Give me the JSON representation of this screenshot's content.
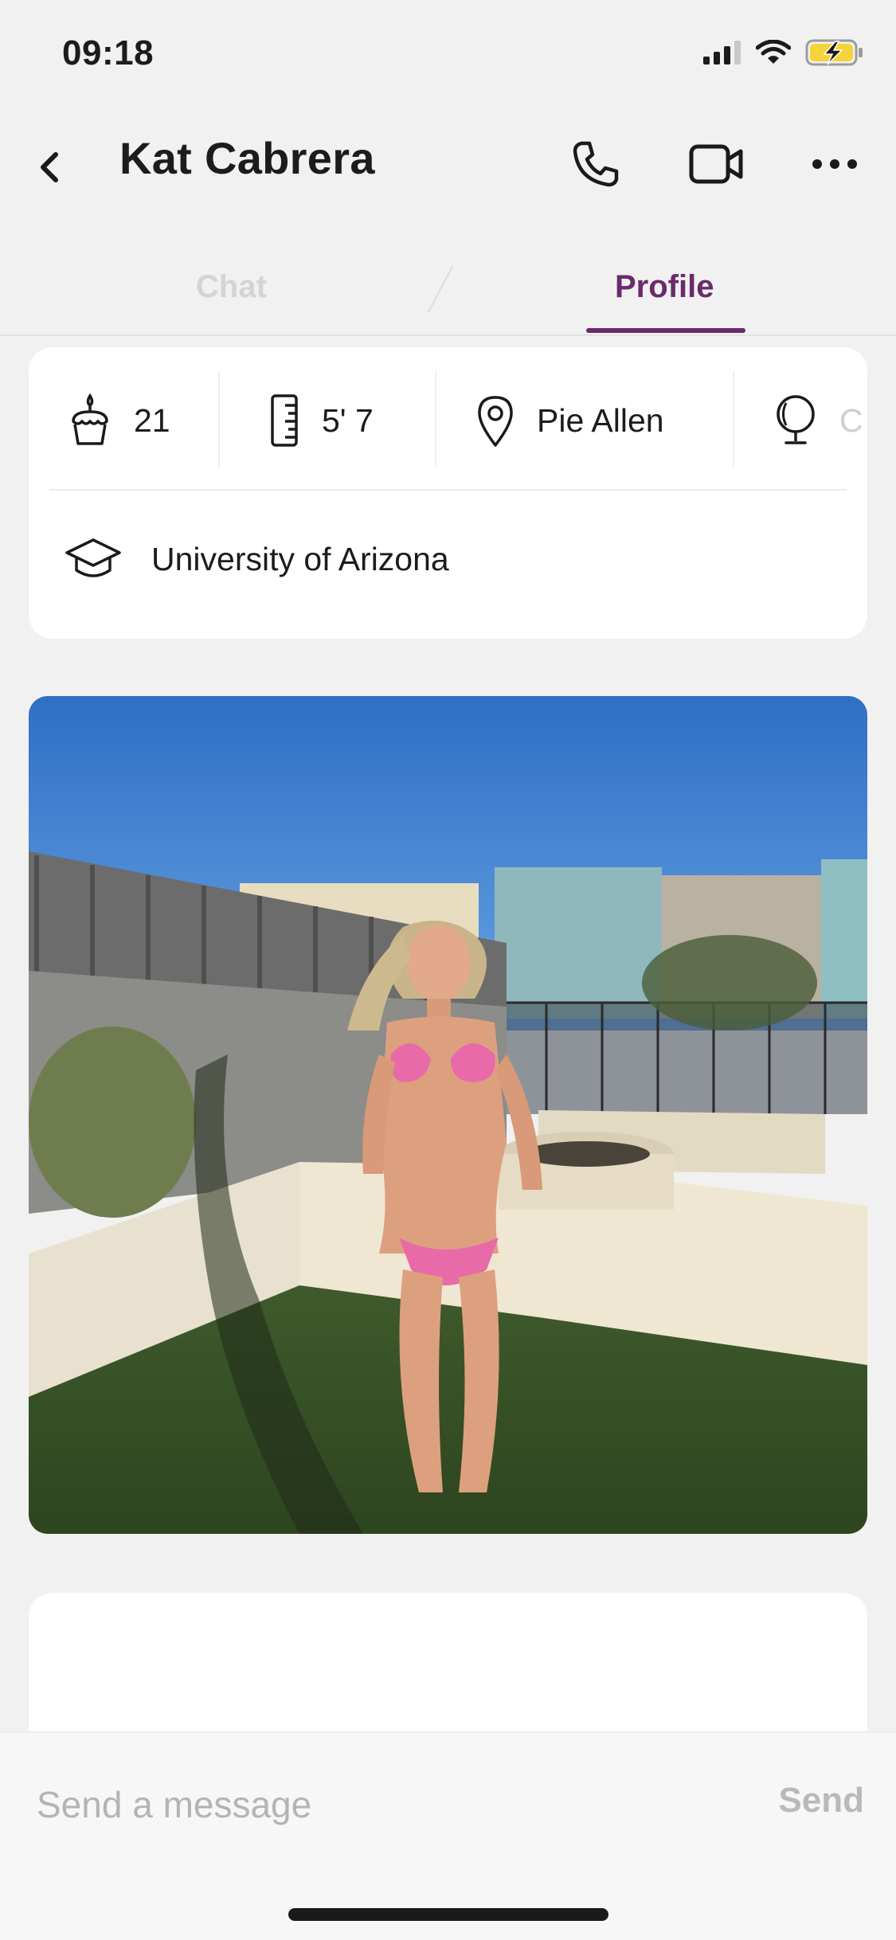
{
  "status_bar": {
    "time": "09:18",
    "icons": [
      "signal-icon",
      "wifi-icon",
      "battery-charging-icon"
    ],
    "battery_color": "#f5d33a"
  },
  "header": {
    "contact_name": "Kat Cabrera",
    "icons": [
      "back-chevron-icon",
      "phone-icon",
      "video-camera-icon",
      "more-dots-icon"
    ]
  },
  "tabs": [
    {
      "label": "Chat",
      "active": false
    },
    {
      "label": "Profile",
      "active": true
    }
  ],
  "accent_color": "#6a2a6b",
  "profile": {
    "age": "21",
    "height": "5' 7",
    "location": "Pie Allen",
    "next_item_partial": "C",
    "education": "University of Arizona",
    "icons": [
      "birthday-cake-icon",
      "ruler-icon",
      "location-pin-icon",
      "globe-icon",
      "graduation-cap-icon"
    ]
  },
  "photo": {
    "subject": "Woman in pink bikini standing on artificial turf in a backyard with a fire pit"
  },
  "composer": {
    "placeholder": "Send a message",
    "send_label": "Send"
  }
}
